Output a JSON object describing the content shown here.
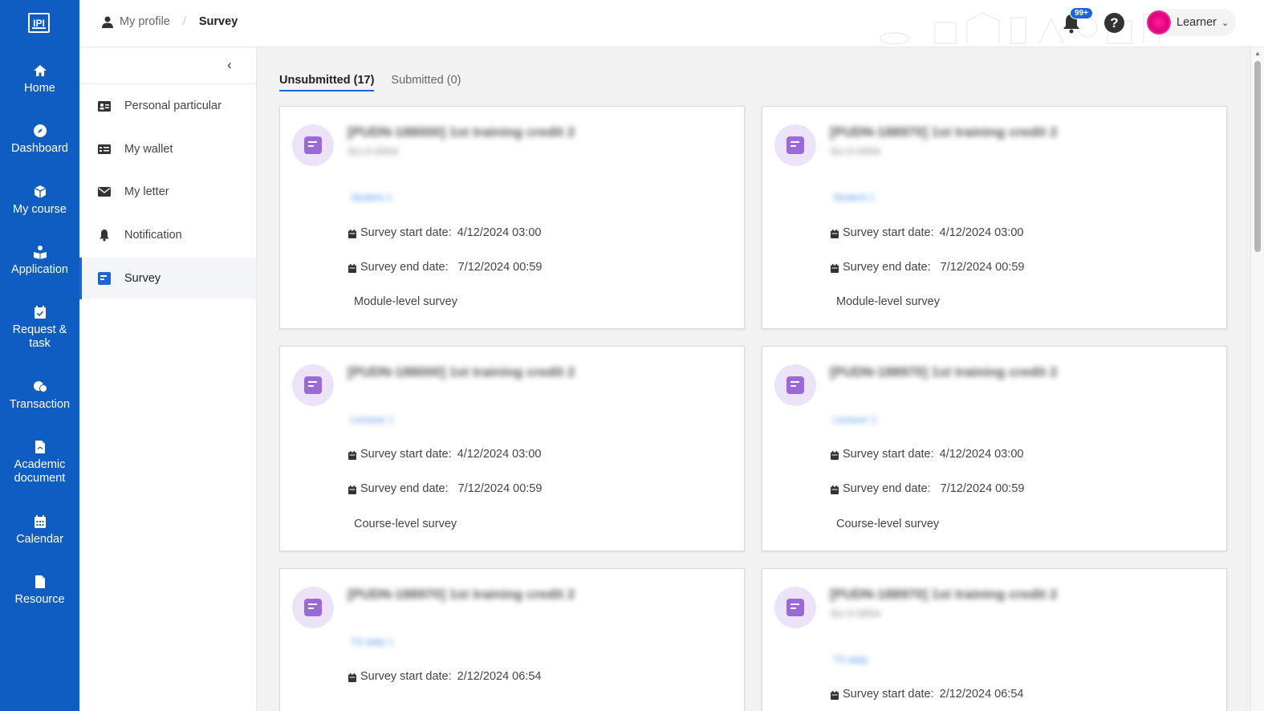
{
  "nav": {
    "logo": "IPI",
    "items": [
      {
        "label": "Home",
        "icon": "home-icon"
      },
      {
        "label": "Dashboard",
        "icon": "compass-icon"
      },
      {
        "label": "My course",
        "icon": "cube-icon"
      },
      {
        "label": "Application",
        "icon": "application-icon"
      },
      {
        "label": "Request & task",
        "icon": "calendar-check-icon"
      },
      {
        "label": "Transaction",
        "icon": "transaction-icon"
      },
      {
        "label": "Academic document",
        "icon": "pdf-file-icon"
      },
      {
        "label": "Calendar",
        "icon": "calendar-icon"
      },
      {
        "label": "Resource",
        "icon": "file-icon"
      }
    ]
  },
  "header": {
    "breadcrumb": {
      "parent": "My profile",
      "separator": "/",
      "current": "Survey"
    },
    "notification_badge": "99+",
    "help": "?",
    "user_name": "Learner"
  },
  "sidebar": {
    "items": [
      {
        "label": "Personal particular",
        "icon": "id-card-icon"
      },
      {
        "label": "My wallet",
        "icon": "wallet-icon"
      },
      {
        "label": "My letter",
        "icon": "envelope-icon"
      },
      {
        "label": "Notification",
        "icon": "bell-icon"
      },
      {
        "label": "Survey",
        "icon": "survey-icon",
        "active": true
      }
    ]
  },
  "tabs": [
    {
      "label": "Unsubmitted (17)",
      "active": true
    },
    {
      "label": "Submitted (0)",
      "active": false
    }
  ],
  "labels": {
    "start": "Survey start date:",
    "end": "Survey end date:"
  },
  "cards": [
    {
      "title": "[PUDN-188000] 1st training credit 2",
      "subtitle": "SU-0-0054",
      "tag": "Student 1",
      "start": "4/12/2024 03:00",
      "end": "7/12/2024 00:59",
      "level": "Module-level survey"
    },
    {
      "title": "[PUDN-188970] 1st training credit 2",
      "subtitle": "SU-0-0054",
      "tag": "Student 1",
      "start": "4/12/2024 03:00",
      "end": "7/12/2024 00:59",
      "level": "Module-level survey"
    },
    {
      "title": "[PUDN-188000] 1st training credit 2",
      "subtitle": "",
      "tag": "Lecturer 1",
      "start": "4/12/2024 03:00",
      "end": "7/12/2024 00:59",
      "level": "Course-level survey"
    },
    {
      "title": "[PUDN-188970] 1st training credit 2",
      "subtitle": "",
      "tag": "Lecturer 1",
      "start": "4/12/2024 03:00",
      "end": "7/12/2024 00:59",
      "level": "Course-level survey"
    },
    {
      "title": "[PUDN-188970] 1st training credit 2",
      "subtitle": "",
      "tag": "TS daily 1",
      "start": "2/12/2024 06:54"
    },
    {
      "title": "[PUDN-188970] 1st training credit 2",
      "subtitle": "SU-0-0054",
      "tag": "TS daily",
      "start": "2/12/2024 06:54"
    }
  ]
}
